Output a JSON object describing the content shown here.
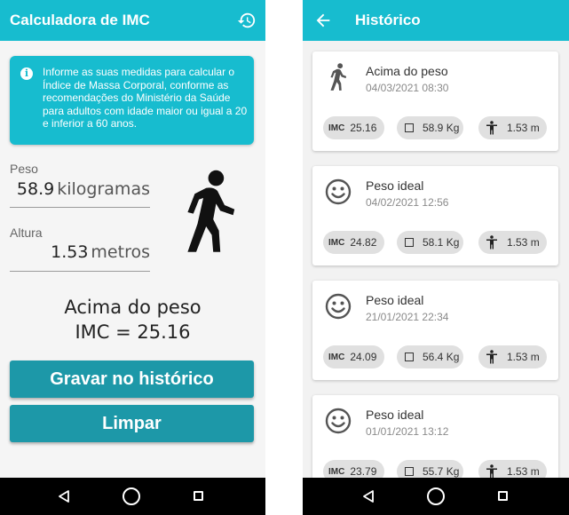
{
  "left_screen": {
    "title": "Calculadora de IMC",
    "info_text": "Informe as suas medidas para calcular o Índice de Massa Corporal, conforme as recomendações do Ministério da Saúde para adultos com idade maior ou igual a 20 e inferior a 60 anos.",
    "peso": {
      "label": "Peso",
      "value": "58.9",
      "unit": "kilogramas"
    },
    "altura": {
      "label": "Altura",
      "value": "1.53",
      "unit": "metros"
    },
    "result_status": "Acima do peso",
    "result_imc": "IMC = 25.16",
    "save_button": "Gravar no histórico",
    "clear_button": "Limpar"
  },
  "right_screen": {
    "title": "Histórico",
    "imc_label": "IMC",
    "records": [
      {
        "status": "Acima do peso",
        "date": "04/03/2021 08:30",
        "imc": "25.16",
        "peso": "58.9 Kg",
        "altura": "1.53 m",
        "icon": "walking-person-icon"
      },
      {
        "status": "Peso ideal",
        "date": "04/02/2021 12:56",
        "imc": "24.82",
        "peso": "58.1 Kg",
        "altura": "1.53 m",
        "icon": "smiley-icon"
      },
      {
        "status": "Peso ideal",
        "date": "21/01/2021 22:34",
        "imc": "24.09",
        "peso": "56.4 Kg",
        "altura": "1.53 m",
        "icon": "smiley-icon"
      },
      {
        "status": "Peso ideal",
        "date": "01/01/2021 13:12",
        "imc": "23.79",
        "peso": "55.7 Kg",
        "altura": "1.53 m",
        "icon": "smiley-icon"
      }
    ]
  },
  "colors": {
    "appbar": "#17bccf",
    "button": "#1d98a8",
    "chip": "#e0e0e0"
  }
}
